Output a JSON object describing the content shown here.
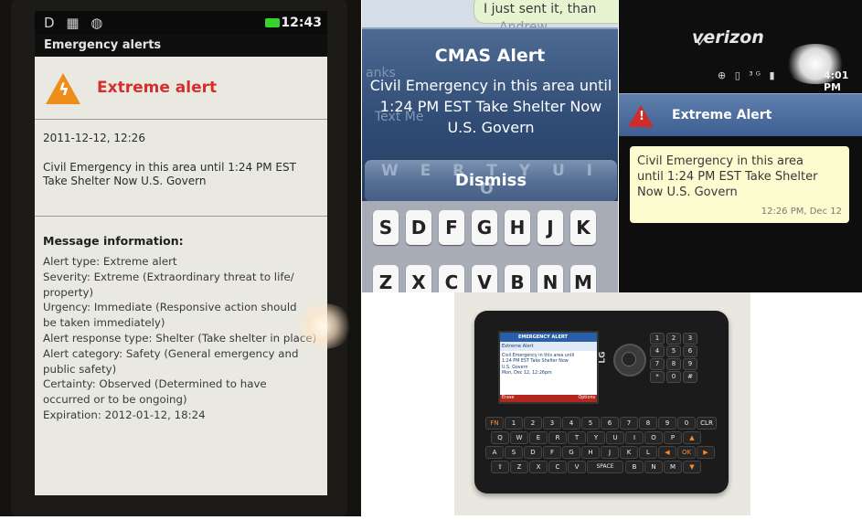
{
  "android_alert": {
    "status_time": "12:43",
    "status_icons": "D ▦ ◍",
    "app_title": "Emergency alerts",
    "alert_title": "Extreme alert",
    "timestamp": "2011-12-12, 12:26",
    "message_line1": "Civil Emergency in this area until 1:24 PM EST",
    "message_line2": "Take Shelter Now U.S. Govern",
    "info_heading": "Message information:",
    "info_items": [
      "Alert type: Extreme alert",
      "Severity: Extreme (Extraordinary threat to life/",
      "property)",
      "Urgency: Immediate (Responsive action should",
      "be taken immediately)",
      "Alert response type: Shelter (Take shelter in place)",
      "Alert category: Safety (General emergency and",
      "public safety)",
      "Certainty: Observed (Determined to have",
      "occurred or to be ongoing)",
      "Expiration: 2012-01-12, 18:24"
    ]
  },
  "iphone_alert": {
    "sent_message": "I just sent it, than",
    "ghost_name": "Andrew",
    "ghost_thanks": "anks",
    "ghost_input": "Text Me",
    "title": "CMAS Alert",
    "message_line1": "Civil Emergency in this area until",
    "message_line2": "1:24 PM EST Take Shelter Now",
    "message_line3": "U.S. Govern",
    "dismiss_label": "Dismiss",
    "ghost_keys": "W E R T Y U I O",
    "keys_row2": [
      "S",
      "D",
      "F",
      "G",
      "H",
      "J",
      "K"
    ],
    "keys_row3": [
      "Z",
      "X",
      "C",
      "V",
      "B",
      "N",
      "M"
    ]
  },
  "verizon_alert": {
    "carrier": "verizon",
    "status_icons": "⊕ ▯ ³ᴳ ▮",
    "status_time": "4:01 PM",
    "header_title": "Extreme Alert",
    "message_line1": "Civil Emergency in this area",
    "message_line2": "until 1:24 PM EST Take Shelter",
    "message_line3": "Now U.S. Govern",
    "timestamp": "12:26 PM, Dec 12"
  },
  "lg_phone": {
    "brand": "LG",
    "screen_header": "EMERGENCY ALERT",
    "screen_subheader": "Extreme Alert",
    "screen_line1": "Civil Emergency in this area until",
    "screen_line2": "1:24 PM EST Take Shelter Now",
    "screen_line3": "U.S. Govern",
    "screen_line4": "Mon, Dec 12, 12:26pm",
    "soft_left": "Erase",
    "soft_right": "Options",
    "num_keys": [
      "1",
      "2",
      "3",
      "4",
      "5",
      "6",
      "7",
      "8",
      "9",
      "*",
      "0",
      "#"
    ],
    "qwerty_row1": [
      "FN",
      "1",
      "2",
      "3",
      "4",
      "5",
      "6",
      "7",
      "8",
      "9",
      "0",
      "CLR"
    ],
    "qwerty_row2": [
      "Q",
      "W",
      "E",
      "R",
      "T",
      "Y",
      "U",
      "I",
      "O",
      "P",
      "▲"
    ],
    "qwerty_row3": [
      "A",
      "S",
      "D",
      "F",
      "G",
      "H",
      "J",
      "K",
      "L",
      "◀",
      "OK",
      "▶"
    ],
    "qwerty_row4": [
      "⇧",
      "Z",
      "X",
      "C",
      "V",
      "SPACE",
      "B",
      "N",
      "M",
      "▼"
    ]
  },
  "colors": {
    "android_red": "#d62d2d",
    "android_orange": "#ee8e1a",
    "ios_blue": "#2f4b74",
    "verizon_blue": "#3d5f92",
    "sms_yellow": "#fdfbd0",
    "lg_red": "#b3261e"
  }
}
